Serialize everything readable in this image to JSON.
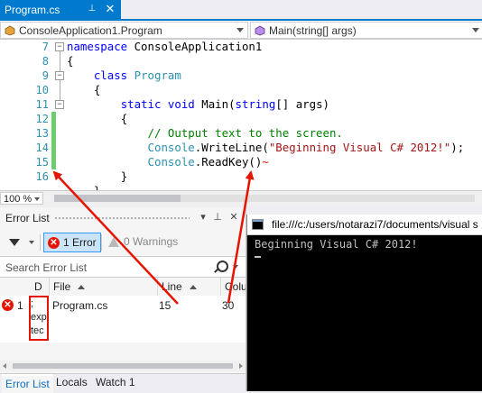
{
  "editor": {
    "tab": {
      "title": "Program.cs"
    },
    "nav": {
      "left": "ConsoleApplication1.Program",
      "right": "Main(string[] args)"
    },
    "zoom": "100 %",
    "line_numbers": [
      "7",
      "8",
      "9",
      "10",
      "11",
      "12",
      "13",
      "14",
      "15",
      "16"
    ],
    "code": {
      "l7_kw": "namespace",
      "l7_rest": " ConsoleApplication1",
      "l8": "{",
      "l9_kw": "class",
      "l9_type": "Program",
      "l10": "{",
      "l11_kw1": "static",
      "l11_kw2": "void",
      "l11_name": "Main(",
      "l11_kw3": "string",
      "l11_rest": "[] args)",
      "l12": "{",
      "l13_comment": "// Output text to the screen.",
      "l14_type": "Console",
      "l14_method": ".WriteLine(",
      "l14_string": "\"Beginning Visual C# 2012!\"",
      "l14_end": ");",
      "l15_type": "Console",
      "l15_method": ".ReadKey()",
      "l15_squiggle": "~",
      "l16": "}",
      "l17": "}"
    }
  },
  "error_list": {
    "title": "Error List",
    "errors_button": "1 Error",
    "warnings_button": "0 Warnings",
    "search_placeholder": "Search Error List",
    "columns": {
      "d": "D",
      "file": "File",
      "line": "Line",
      "col": "Colu"
    },
    "row": {
      "num": "1",
      "desc_lines": [
        ";",
        "exp",
        "tec"
      ],
      "file": "Program.cs",
      "line": "15",
      "col": "30"
    },
    "bottom_tabs": [
      "Error List",
      "Locals",
      "Watch 1"
    ]
  },
  "console": {
    "title": "file:///c:/users/notarazi7/documents/visual s",
    "output": "Beginning Visual C# 2012!"
  },
  "colors": {
    "accent": "#007acc",
    "error_red": "#e51400",
    "keyword": "#0000ff",
    "type": "#2b91af",
    "comment": "#008000",
    "string": "#a31515",
    "changed_line": "#6ccd6c"
  }
}
